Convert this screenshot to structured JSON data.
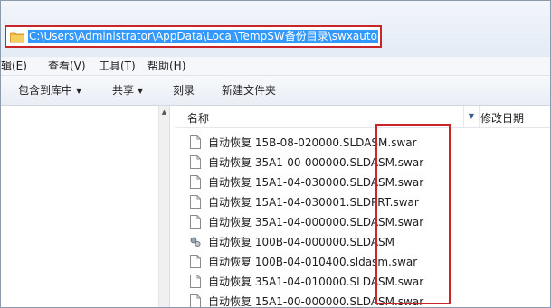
{
  "address": {
    "path": "C:\\Users\\Administrator\\AppData\\Local\\TempSW备份目录\\swxauto"
  },
  "menu": [
    {
      "label": "编辑(E)"
    },
    {
      "label": "查看(V)"
    },
    {
      "label": "工具(T)"
    },
    {
      "label": "帮助(H)"
    }
  ],
  "toolbar": {
    "include_in_library": "包含到库中",
    "share": "共享",
    "burn": "刻录",
    "new_folder": "新建文件夹"
  },
  "columns": {
    "name": "名称",
    "date_modified": "修改日期"
  },
  "files": [
    {
      "name": "自动恢复 15B-08-020000.SLDASM.swar",
      "icon": "document-icon"
    },
    {
      "name": "自动恢复 35A1-00-000000.SLDASM.swar",
      "icon": "document-icon"
    },
    {
      "name": "自动恢复 15A1-04-030000.SLDASM.swar",
      "icon": "document-icon"
    },
    {
      "name": "自动恢复 15A1-04-030001.SLDPRT.swar",
      "icon": "document-icon"
    },
    {
      "name": "自动恢复 35A1-04-000000.SLDASM.swar",
      "icon": "document-icon"
    },
    {
      "name": "自动恢复 100B-04-000000.SLDASM",
      "icon": "assembly-icon"
    },
    {
      "name": "自动恢复 100B-04-010400.sldasm.swar",
      "icon": "document-icon"
    },
    {
      "name": "自动恢复 35A1-04-010000.SLDASM.swar",
      "icon": "document-icon"
    },
    {
      "name": "自动恢复 15A1-00-000000.SLDASM.swar",
      "icon": "document-icon"
    }
  ],
  "colors": {
    "highlight": "#c8262a",
    "selection": "#3399ff"
  }
}
